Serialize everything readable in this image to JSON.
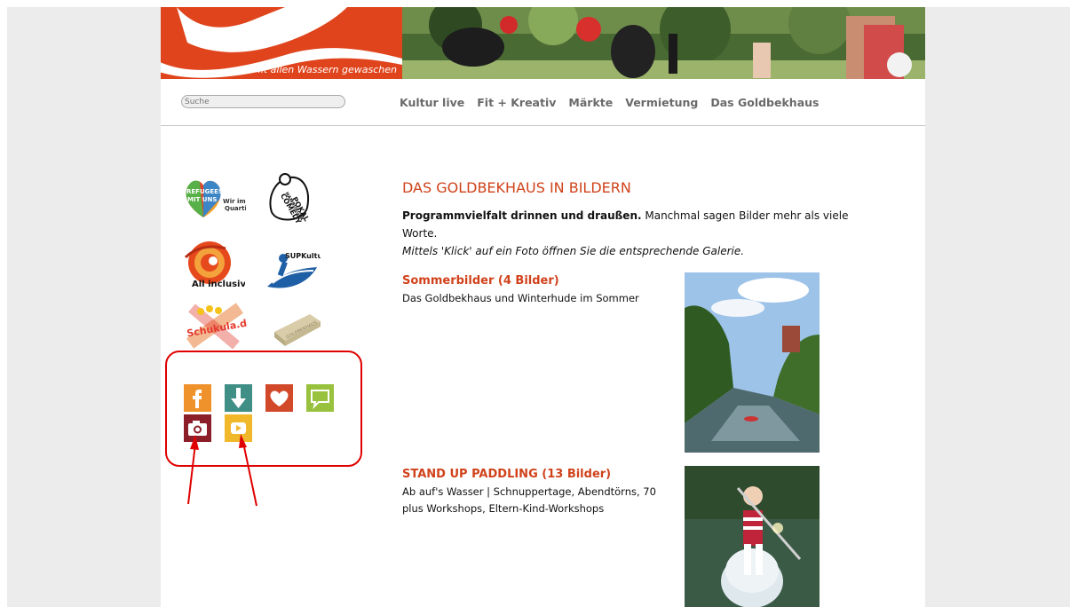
{
  "header": {
    "tagline": "Mit allen Wassern gewaschen"
  },
  "search": {
    "placeholder": "Suche"
  },
  "nav": {
    "items": [
      "Kultur live",
      "Fit + Kreativ",
      "Märkte",
      "Vermietung",
      "Das Goldbekhaus"
    ]
  },
  "sidebar": {
    "logos": [
      {
        "name": "refugees-logo",
        "text_a": "REFUGEES",
        "text_b": "MIT UNS",
        "text_c": "Wir im",
        "text_d": "Quartier"
      },
      {
        "name": "comedy-pokal-logo",
        "text_a": "HAMBURGER",
        "text_b": "COMEDY",
        "text_c": "POKAL"
      },
      {
        "name": "all-inclusive-logo",
        "text": "All inclusive"
      },
      {
        "name": "supkultur-logo",
        "text": "SUPKultur"
      },
      {
        "name": "schukula-logo",
        "text": "Schukula.de"
      },
      {
        "name": "gold-bar-logo",
        "text": "GOLDBEKHAUS"
      }
    ],
    "social_icons": [
      "facebook-icon",
      "download-icon",
      "heart-icon",
      "speech-bubble-icon",
      "camera-icon",
      "youtube-icon"
    ],
    "colors": {
      "facebook": "#f0922c",
      "download": "#3f8f86",
      "heart": "#d2492a",
      "speech": "#98c13d",
      "camera": "#8c1e2a",
      "youtube": "#f1b82c",
      "highlight": "#e00000"
    }
  },
  "main": {
    "title": "DAS GOLDBEKHAUS IN BILDERN",
    "intro_bold": "Programmvielfalt drinnen und draußen.",
    "intro_rest": " Manchmal sagen Bilder mehr als viele Worte.",
    "intro_italic": "Mittels 'Klick' auf ein Foto öffnen Sie die entsprechende Galerie.",
    "galleries": [
      {
        "title": "Sommerbilder (4 Bilder)",
        "desc": "Das Goldbekhaus und Winterhude im Sommer"
      },
      {
        "title": "STAND UP PADDLING (13 Bilder)",
        "desc": "Ab auf's Wasser | Schnuppertage, Abendtörns, 70 plus Workshops, Eltern-Kind-Workshops"
      }
    ]
  },
  "accent_color": "#d0421b"
}
